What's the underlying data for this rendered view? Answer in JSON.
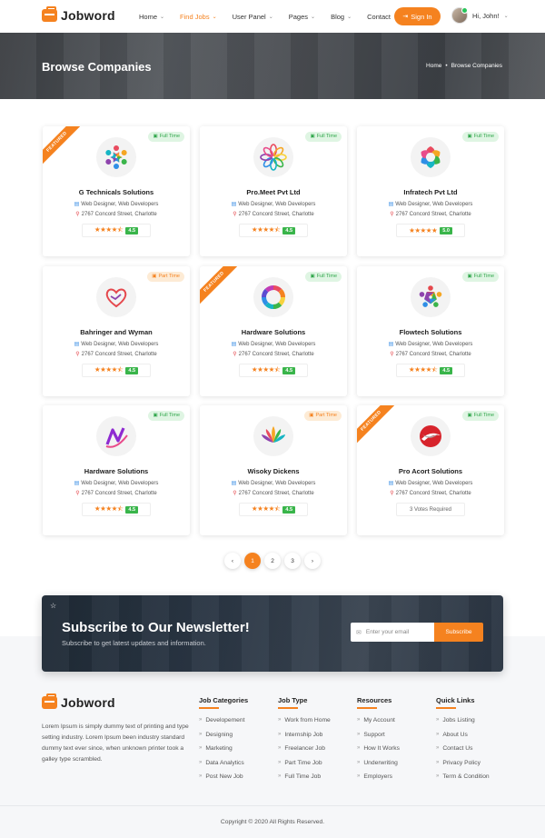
{
  "brand": {
    "name": "Jobword"
  },
  "nav": [
    {
      "label": "Home",
      "dropdown": true,
      "active": false
    },
    {
      "label": "Find Jobs",
      "dropdown": true,
      "active": true
    },
    {
      "label": "User Panel",
      "dropdown": true,
      "active": false
    },
    {
      "label": "Pages",
      "dropdown": true,
      "active": false
    },
    {
      "label": "Blog",
      "dropdown": true,
      "active": false
    },
    {
      "label": "Contact",
      "dropdown": false,
      "active": false
    }
  ],
  "header": {
    "signin_label": "Sign In",
    "user_greeting": "Hi, John!"
  },
  "banner": {
    "title": "Browse Companies",
    "breadcrumb": [
      "Home",
      "Browse Companies"
    ]
  },
  "companies": [
    {
      "name": "G Technicals Solutions",
      "type": "Full Time",
      "featured": true,
      "category": "Web Designer, Web Developers",
      "address": "2767 Concord Street, Charlotte",
      "stars": 4.5,
      "score": "4.5",
      "logo": "people-circle-logo"
    },
    {
      "name": "Pro.Meet Pvt Ltd",
      "type": "Full Time",
      "featured": false,
      "category": "Web Designer, Web Developers",
      "address": "2767 Concord Street, Charlotte",
      "stars": 4.5,
      "score": "4.5",
      "logo": "swirl-flower-logo"
    },
    {
      "name": "Infratech Pvt Ltd",
      "type": "Full Time",
      "featured": false,
      "category": "Web Designer, Web Developers",
      "address": "2767 Concord Street, Charlotte",
      "stars": 5,
      "score": "5.0",
      "logo": "petal-ring-logo"
    },
    {
      "name": "Bahringer and Wyman",
      "type": "Part Time",
      "featured": false,
      "category": "Web Designer, Web Developers",
      "address": "2767 Concord Street, Charlotte",
      "stars": 4.5,
      "score": "4.5",
      "logo": "heart-hands-logo"
    },
    {
      "name": "Hardware Solutions",
      "type": "Full Time",
      "featured": true,
      "category": "Web Designer, Web Developers",
      "address": "2767 Concord Street, Charlotte",
      "stars": 4.5,
      "score": "4.5",
      "logo": "rainbow-ring-logo"
    },
    {
      "name": "Flowtech Solutions",
      "type": "Full Time",
      "featured": false,
      "category": "Web Designer, Web Developers",
      "address": "2767 Concord Street, Charlotte",
      "stars": 4.5,
      "score": "4.5",
      "logo": "team-circle-logo"
    },
    {
      "name": "Hardware Solutions",
      "type": "Full Time",
      "featured": false,
      "category": "Web Designer, Web Developers",
      "address": "2767 Concord Street, Charlotte",
      "stars": 4.5,
      "score": "4.5",
      "logo": "n-swoosh-logo"
    },
    {
      "name": "Wisoky Dickens",
      "type": "Part Time",
      "featured": false,
      "category": "Web Designer, Web Developers",
      "address": "2767 Concord Street, Charlotte",
      "stars": 4.5,
      "score": "4.5",
      "logo": "lotus-logo"
    },
    {
      "name": "Pro Acort Solutions",
      "type": "Full Time",
      "featured": true,
      "category": "Web Designer, Web Developers",
      "address": "2767 Concord Street, Charlotte",
      "votes": "3 Votes Required",
      "logo": "red-swirl-logo"
    }
  ],
  "featured_label": "FEATURED",
  "pagination": {
    "pages": [
      "1",
      "2",
      "3"
    ],
    "current": "1",
    "prev": "‹",
    "next": "›"
  },
  "newsletter": {
    "title": "Subscribe to Our Newsletter!",
    "subtitle": "Subscribe to get latest updates and information.",
    "email_placeholder": "Enter your email",
    "button_label": "Subscribe"
  },
  "footer": {
    "description": "Lorem Ipsum is simply dummy text of printing and type setting industry. Lorem Ipsum been industry standard dummy text ever since, when unknown printer took a galley type scrambled.",
    "columns": [
      {
        "title": "Job Categories",
        "links": [
          "Developement",
          "Designing",
          "Marketing",
          "Data Analytics",
          "Post New Job"
        ]
      },
      {
        "title": "Job Type",
        "links": [
          "Work from Home",
          "Internship Job",
          "Freelancer Job",
          "Part Time Job",
          "Full Time Job"
        ]
      },
      {
        "title": "Resources",
        "links": [
          "My Account",
          "Support",
          "How It Works",
          "Underwriting",
          "Employers"
        ]
      },
      {
        "title": "Quick Links",
        "links": [
          "Jobs Listing",
          "About Us",
          "Contact Us",
          "Privacy Policy",
          "Term & Condition"
        ]
      }
    ],
    "copyright": "Copyright © 2020 All Rights Reserved."
  },
  "colors": {
    "accent": "#f5821f",
    "score_green": "#39b54a",
    "full_time": "#2fa64a",
    "part_time": "#f5821f"
  }
}
